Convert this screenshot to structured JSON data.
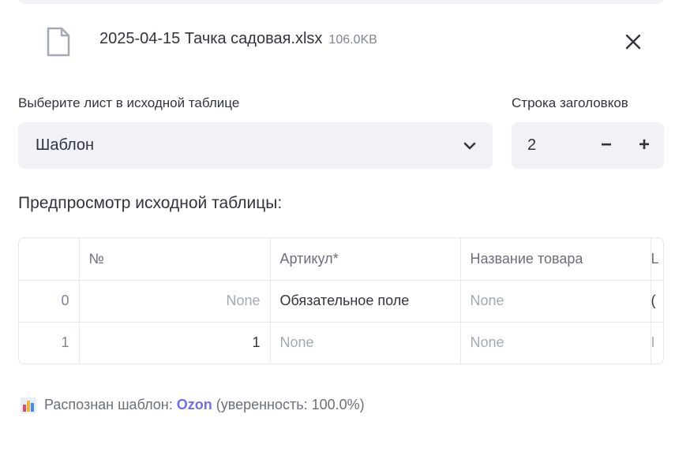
{
  "file": {
    "name": "2025-04-15 Тачка садовая.xlsx",
    "size": "106.0KB"
  },
  "sheet_select": {
    "label": "Выберите лист в исходной таблице",
    "value": "Шаблон"
  },
  "header_row": {
    "label": "Строка заголовков",
    "value": "2",
    "minus": "−",
    "plus": "+"
  },
  "preview": {
    "title": "Предпросмотр исходной таблицы:",
    "columns": [
      "",
      "№",
      "Артикул*",
      "Название товара",
      "L"
    ],
    "rows": [
      {
        "index": "0",
        "num": "None",
        "article": "Обязательное поле",
        "name": "None",
        "cut": "("
      },
      {
        "index": "1",
        "num": "1",
        "article": "None",
        "name": "None",
        "cut": "I"
      }
    ]
  },
  "status": {
    "prefix": "Распознан шаблон:",
    "template": "Ozon",
    "suffix": "(уверенность: 100.0%)"
  },
  "colors": {
    "accent": "#6e6ef0",
    "input_bg": "#f0f2f6"
  }
}
